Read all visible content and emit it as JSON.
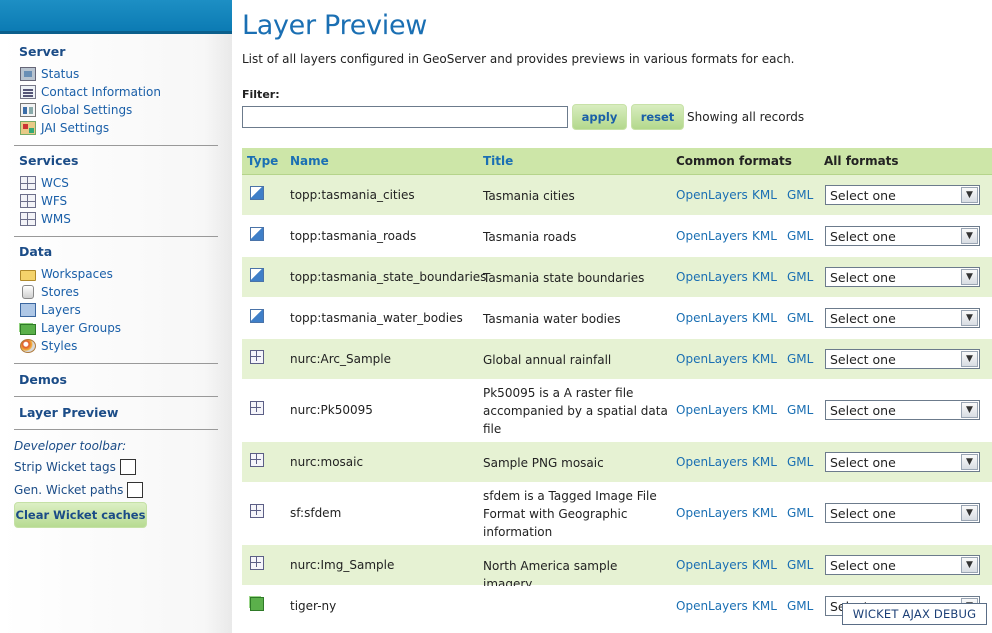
{
  "sidebar": {
    "sections": {
      "server": "Server",
      "services": "Services",
      "data": "Data",
      "demos": "Demos",
      "layer_preview": "Layer Preview"
    },
    "server_items": [
      {
        "label": "Status",
        "icon": "status-icon"
      },
      {
        "label": "Contact Information",
        "icon": "contact-icon"
      },
      {
        "label": "Global Settings",
        "icon": "global-settings-icon"
      },
      {
        "label": "JAI Settings",
        "icon": "jai-icon"
      }
    ],
    "services_items": [
      {
        "label": "WCS",
        "icon": "grid-icon"
      },
      {
        "label": "WFS",
        "icon": "grid-icon"
      },
      {
        "label": "WMS",
        "icon": "grid-icon"
      }
    ],
    "data_items": [
      {
        "label": "Workspaces",
        "icon": "folder-icon"
      },
      {
        "label": "Stores",
        "icon": "store-icon"
      },
      {
        "label": "Layers",
        "icon": "layer-icon"
      },
      {
        "label": "Layer Groups",
        "icon": "layer-group-icon"
      },
      {
        "label": "Styles",
        "icon": "styles-icon"
      }
    ],
    "developer_toolbar": {
      "label": "Developer toolbar:",
      "strip_tags": "Strip Wicket tags",
      "gen_paths": "Gen. Wicket paths",
      "clear_caches": "Clear Wicket caches"
    }
  },
  "main": {
    "title": "Layer Preview",
    "description": "List of all layers configured in GeoServer and provides previews in various formats for each.",
    "filter": {
      "label": "Filter:",
      "value": "",
      "apply": "apply",
      "reset": "reset",
      "status": "Showing all records"
    },
    "table": {
      "headers": {
        "type": "Type",
        "name": "Name",
        "title": "Title",
        "common": "Common formats",
        "all": "All formats"
      },
      "format_links": [
        "OpenLayers",
        "KML",
        "GML"
      ],
      "select_placeholder": "Select one",
      "rows": [
        {
          "type": "vector",
          "name": "topp:tasmania_cities",
          "title": "Tasmania cities"
        },
        {
          "type": "vector",
          "name": "topp:tasmania_roads",
          "title": "Tasmania roads"
        },
        {
          "type": "vector",
          "name": "topp:tasmania_state_boundaries",
          "title": "Tasmania state boundaries"
        },
        {
          "type": "vector",
          "name": "topp:tasmania_water_bodies",
          "title": "Tasmania water bodies"
        },
        {
          "type": "raster",
          "name": "nurc:Arc_Sample",
          "title": "Global annual rainfall"
        },
        {
          "type": "raster",
          "name": "nurc:Pk50095",
          "title": "Pk50095 is a A raster file accompanied by a spatial data file"
        },
        {
          "type": "raster",
          "name": "nurc:mosaic",
          "title": "Sample PNG mosaic"
        },
        {
          "type": "raster",
          "name": "sf:sfdem",
          "title": "sfdem is a Tagged Image File Format with Geographic information"
        },
        {
          "type": "raster",
          "name": "nurc:Img_Sample",
          "title": "North America sample imagery"
        },
        {
          "type": "group",
          "name": "tiger-ny",
          "title": ""
        }
      ]
    }
  },
  "debug": {
    "label": "WICKET AJAX DEBUG"
  },
  "colors": {
    "header_blue": "#0a79b2",
    "link_blue": "#1a6fb3",
    "nav_blue": "#1b4c87",
    "row_green": "#e6f2d3",
    "header_green": "#cde6a8"
  }
}
